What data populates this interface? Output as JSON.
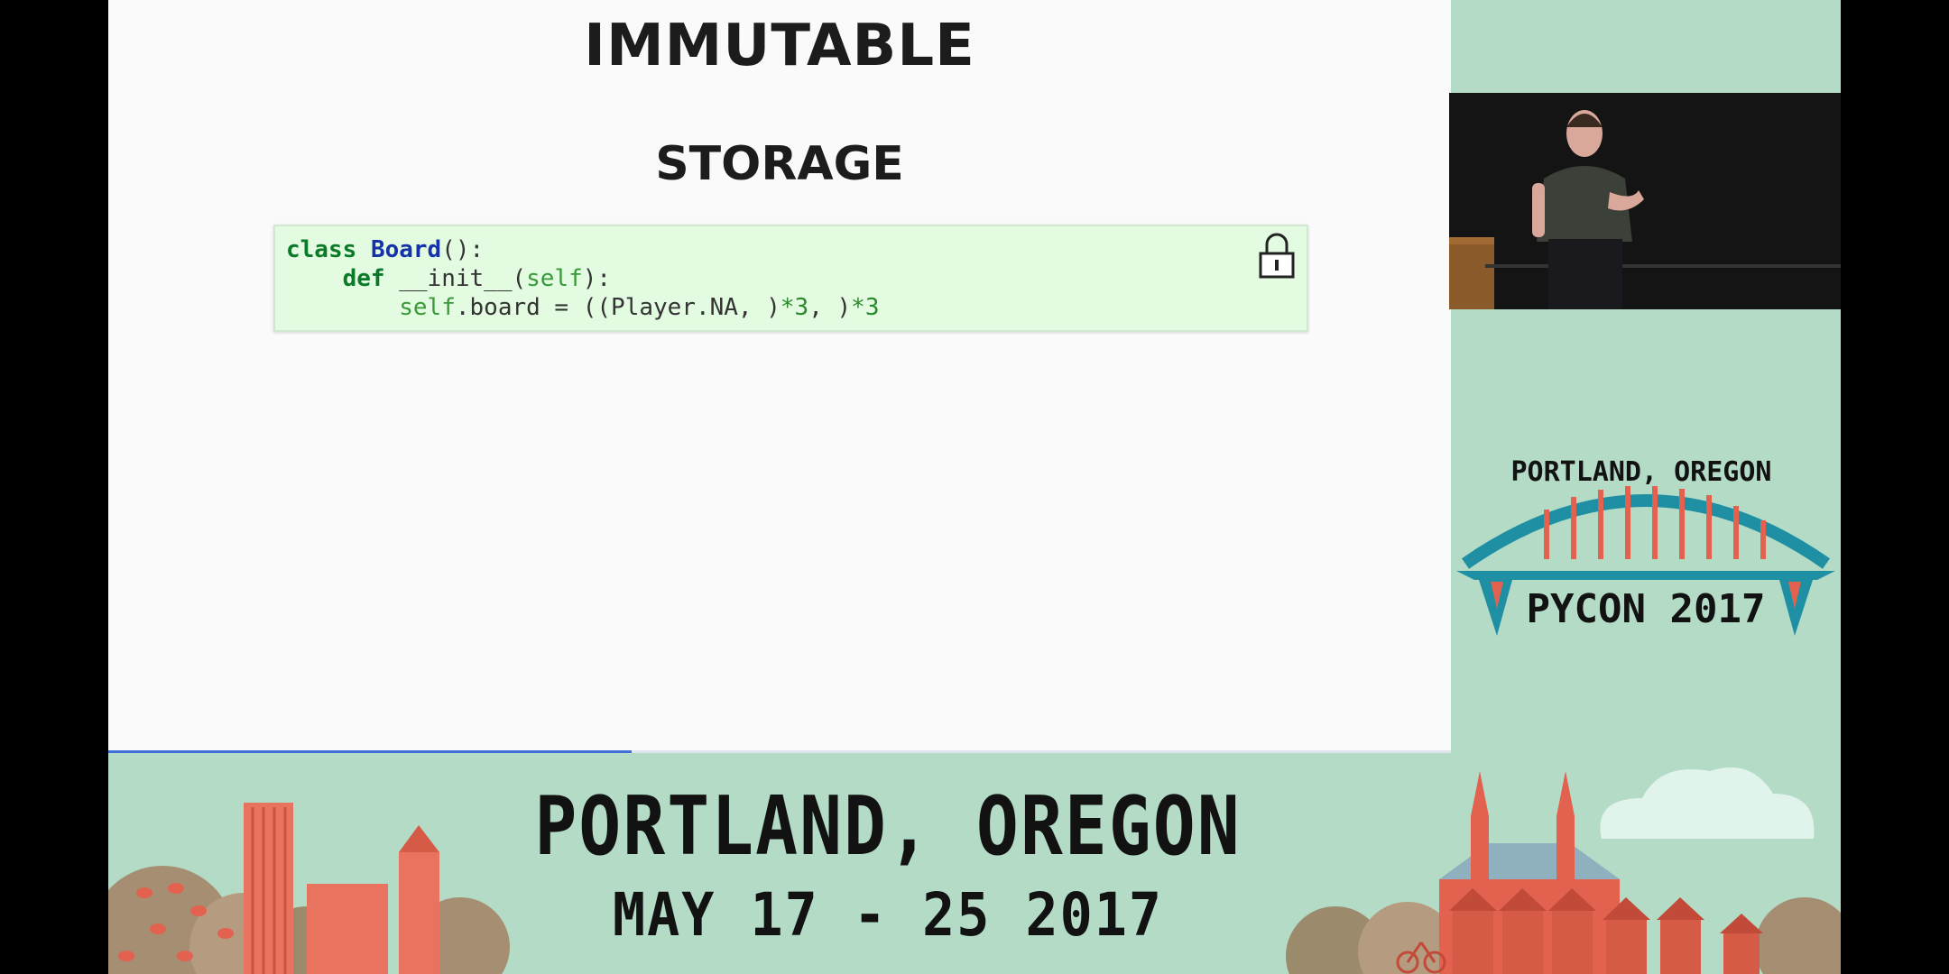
{
  "slide": {
    "title": "IMMUTABLE",
    "subtitle": "STORAGE",
    "code": {
      "line1": {
        "kw": "class",
        "name": "Board",
        "rest": "():"
      },
      "line2": {
        "indent": "    ",
        "kw": "def",
        "rest": " __init__(",
        "self": "self",
        "end": "):"
      },
      "line3": {
        "indent": "        ",
        "self": "self",
        "mid": ".board = ((Player.NA, )",
        "m1": "*3",
        "sep": ", )",
        "m2": "*3"
      }
    },
    "lock_icon": "lock-icon",
    "progress": 0.39
  },
  "video": {
    "icon": "speaker-video"
  },
  "logo": {
    "line1": "PORTLAND, OREGON",
    "line2": "PYCON 2017"
  },
  "banner": {
    "line1": "PORTLAND, OREGON",
    "line2": "MAY 17 - 25 2017"
  },
  "colors": {
    "background": "#b3dbc6",
    "bridge": "#1f8fa3",
    "bridge_red": "#e2614f",
    "progress": "#3d6fd8"
  }
}
